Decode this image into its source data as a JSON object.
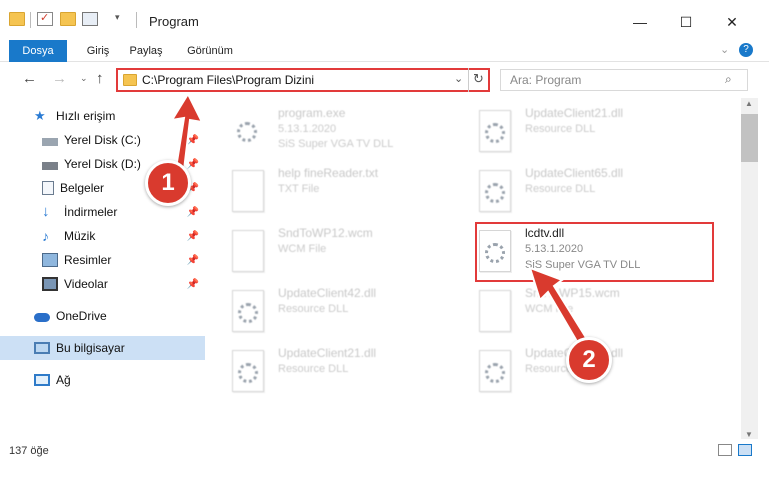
{
  "window": {
    "title": "Program"
  },
  "ribbon": {
    "tabs": [
      "Dosya",
      "Giriş",
      "Paylaş",
      "Görünüm"
    ]
  },
  "address": {
    "path": "C:\\Program Files\\Program Dizini"
  },
  "search": {
    "placeholder": "Ara: Program"
  },
  "sidebar": {
    "quick_access": "Hızlı erişim",
    "items": [
      {
        "label": "Yerel Disk (C:)",
        "icon": "drive-icon"
      },
      {
        "label": "Yerel Disk (D:)",
        "icon": "drive-icon"
      },
      {
        "label": "Belgeler",
        "icon": "documents-icon"
      },
      {
        "label": "İndirmeler",
        "icon": "download-icon"
      },
      {
        "label": "Müzik",
        "icon": "music-icon"
      },
      {
        "label": "Resimler",
        "icon": "pictures-icon"
      },
      {
        "label": "Videolar",
        "icon": "video-icon"
      }
    ],
    "onedrive": "OneDrive",
    "this_pc": "Bu bilgisayar",
    "network": "Ağ"
  },
  "files": [
    {
      "name": "program.exe",
      "line2": "5.13.1.2020",
      "line3": "SiS Super VGA TV DLL"
    },
    {
      "name": "help fineReader.txt",
      "line2": "TXT File"
    },
    {
      "name": "SndToWP12.wcm",
      "line2": "WCM File"
    },
    {
      "name": "UpdateClient42.dll",
      "line2": "Resource DLL"
    },
    {
      "name": "UpdateClient21.dll",
      "line2": "Resource DLL"
    },
    {
      "name": "UpdateClient21.dll",
      "line2": "Resource DLL"
    },
    {
      "name": "UpdateClient65.dll",
      "line2": "Resource DLL"
    },
    {
      "name": "lcdtv.dll",
      "line2": "5.13.1.2020",
      "line3": "SiS Super VGA TV DLL"
    },
    {
      "name": "SndToWP15.wcm",
      "line2": "WCM File"
    },
    {
      "name": "UpdateClient42.dll",
      "line2": "Resource DLL"
    }
  ],
  "annotations": {
    "step1": "1",
    "step2": "2"
  },
  "status": {
    "count": "137 öğe"
  },
  "colors": {
    "accent": "#1979ca",
    "highlight": "#e23a3a",
    "badge": "#d93a2e"
  }
}
